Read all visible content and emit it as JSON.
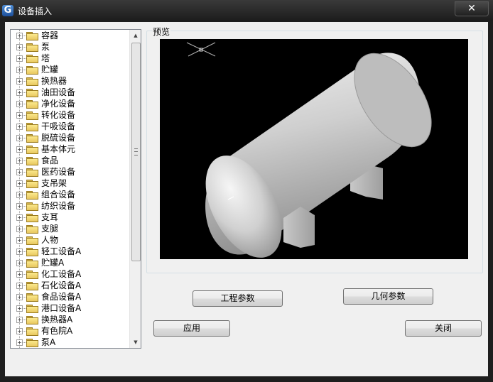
{
  "window": {
    "title": "设备插入",
    "app_icon_letter": "G",
    "close_glyph": "✕"
  },
  "tree": {
    "expander_glyph": "+",
    "items": [
      "容器",
      "泵",
      "塔",
      "贮罐",
      "换热器",
      "油田设备",
      "净化设备",
      "转化设备",
      "干吸设备",
      "脱硫设备",
      "基本体元",
      "食品",
      "医药设备",
      "支吊架",
      "组合设备",
      "纺织设备",
      "支耳",
      "支腿",
      "人物",
      "轻工设备A",
      "贮罐A",
      "化工设备A",
      "石化设备A",
      "食品设备A",
      "港口设备A",
      "换热器A",
      "有色院A",
      "泵A"
    ],
    "scroll_up_glyph": "▲",
    "scroll_down_glyph": "▼"
  },
  "preview": {
    "label": "预览"
  },
  "buttons": {
    "engineering_params": "工程参数",
    "geometry_params": "几何参数",
    "apply": "应用",
    "close": "关闭"
  }
}
